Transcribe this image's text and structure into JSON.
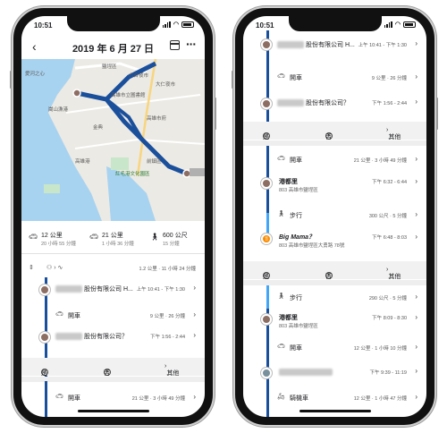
{
  "left": {
    "status_time": "10:51",
    "date_title": "2019 年 6 月 27 日",
    "map_labels": [
      "鹽埕區",
      "愛河之心",
      "六合夜市",
      "大仁夜市",
      "高雄市立圖書館",
      "高雄市府",
      "崗山漁港",
      "紅毛港文化園區",
      "高雄港",
      "金典",
      "前鎮區"
    ],
    "summary": [
      {
        "icon": "car-icon",
        "value": "12 公里",
        "sub": "20 小時 55 分鐘"
      },
      {
        "icon": "car-icon",
        "value": "21 公里",
        "sub": "1 小時 36 分鐘"
      },
      {
        "icon": "walk-icon",
        "value": "600 公尺",
        "sub": "15 分鐘"
      }
    ],
    "filter_summary": "1.2 公里 · 11 小時 24 分鐘",
    "entries": [
      {
        "name": "股份有限公司 H...",
        "time": "上午 10:41 - 下午 1:30"
      },
      {
        "activity": "開車",
        "meta": "9 公里 · 26 分鐘"
      },
      {
        "name": "股份有限公司？",
        "time": "下午 1:56 - 2:44"
      }
    ],
    "confirm": {
      "yes": "是",
      "no": "否",
      "other": "其他"
    },
    "last_activity": {
      "activity": "開車",
      "meta": "21 公里 · 3 小時 49 分鐘"
    }
  },
  "right": {
    "status_time": "10:51",
    "entries": [
      {
        "name": "股份有限公司 H...",
        "time": "上午 10:41 - 下午 1:30"
      },
      {
        "activity": "開車",
        "meta": "9 公里 · 26 分鐘"
      },
      {
        "name": "股份有限公司？",
        "time": "下午 1:56 - 2:44"
      },
      {
        "activity": "開車",
        "meta": "21 公里 · 3 小時 49 分鐘"
      },
      {
        "name": "港都里",
        "addr": "803 高雄市鹽埕區",
        "time": "下午 6:32 - 6:44"
      },
      {
        "activity": "步行",
        "meta": "300 公尺 · 5 分鐘"
      },
      {
        "name": "Big Mama？",
        "addr": "803 高雄市鹽埕區大勇路 78號",
        "time": "下午 6:48 - 8:03"
      },
      {
        "activity": "步行",
        "meta": "290 公尺 · 5 分鐘"
      },
      {
        "name": "港都里",
        "addr": "803 高雄市鹽埕區",
        "time": "下午 8:09 - 8:30"
      },
      {
        "activity": "開車",
        "meta": "12 公里 · 1 小時 10 分鐘"
      },
      {
        "name": "",
        "time": "下午 9:39 - 11:19"
      },
      {
        "activity": "騎機車",
        "meta": "12 公里 · 1 小時 47 分鐘"
      }
    ],
    "confirm": {
      "yes": "是",
      "no": "否",
      "other": "其他"
    }
  }
}
